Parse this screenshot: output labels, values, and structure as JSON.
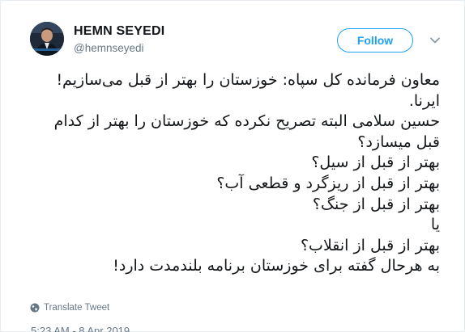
{
  "user": {
    "display_name": "HEMN SEYEDI",
    "handle": "@hemnseyedi"
  },
  "follow_label": "Follow",
  "icons": {
    "avatar": "avatar",
    "more": "chevron-down-icon",
    "translate": "globe-icon"
  },
  "colors": {
    "accent": "#1da1f2",
    "text": "#14171a",
    "secondary": "#657786"
  },
  "tweet": {
    "lines": [
      "معاون فرمانده کل سپاه: خوزستان را بهتر از قبل می‌سازیم!",
      "ایرنا.",
      "حسین سلامی البته تصریح نکرده که خوزستان را بهتر از کدام",
      "قبل میسازد؟",
      "بهتر از قبل از سیل؟",
      "بهتر از قبل از ریزگرد و قطعی آب؟",
      "بهتر از قبل از جنگ؟",
      "یا",
      "بهتر از قبل از انقلاب؟",
      "به هرحال گفته برای خوزستان برنامه بلندمدت دارد!"
    ]
  },
  "translate_label": "Translate Tweet",
  "timestamp": "5:23 AM - 8 Apr 2019"
}
